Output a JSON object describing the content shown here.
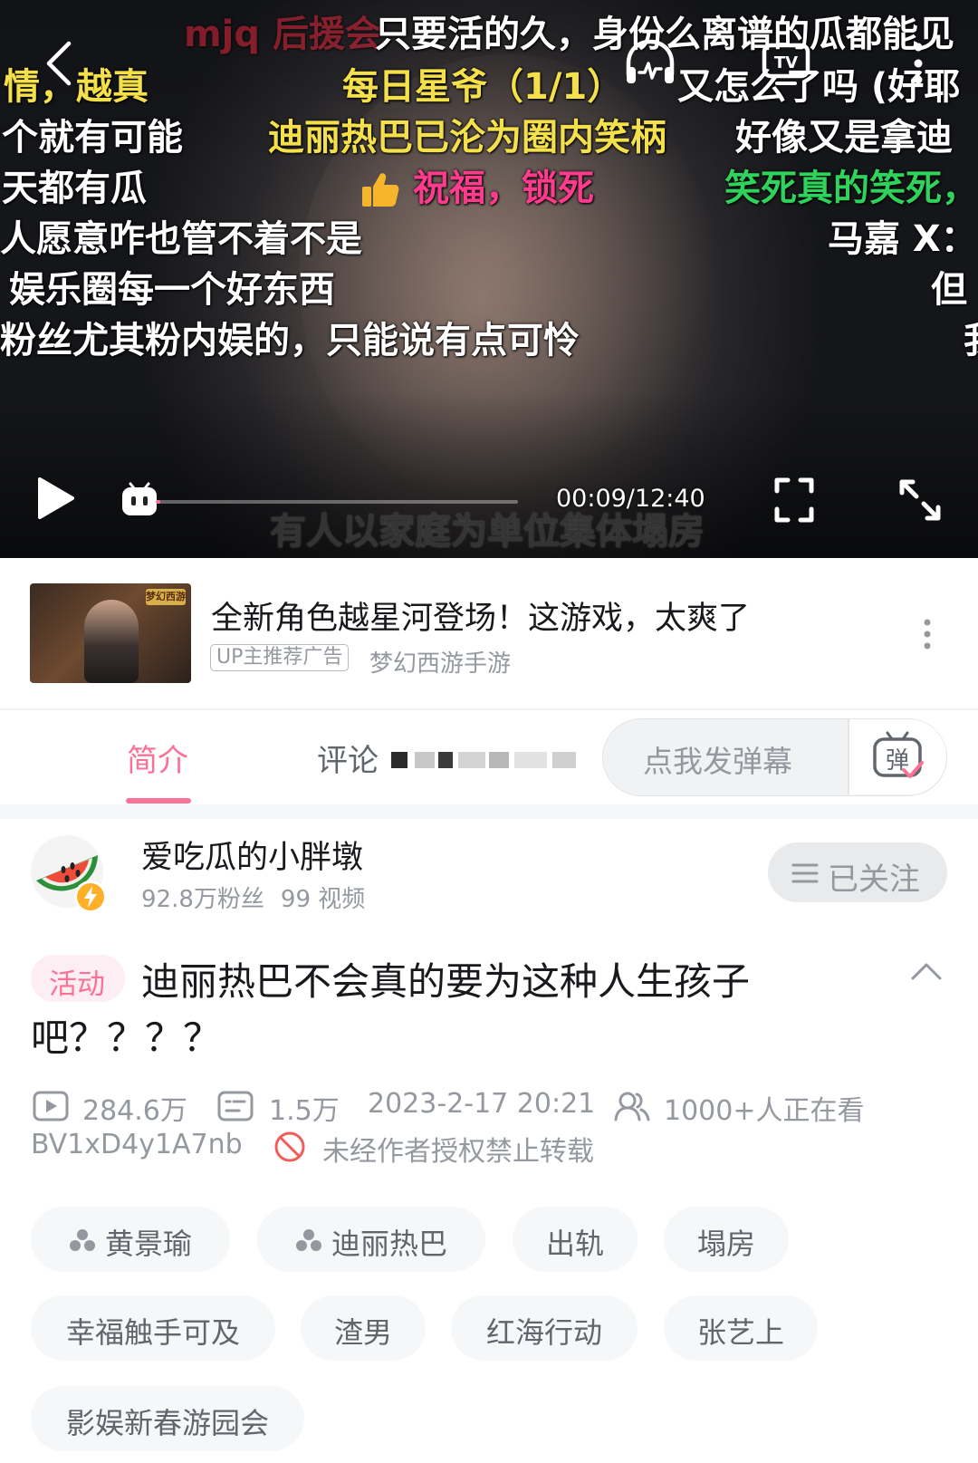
{
  "player": {
    "danmaku": [
      {
        "text": "mjq 后援会",
        "color": "red"
      },
      {
        "text": "只要活的久，身份么离谱的瓜都能见",
        "color": "white"
      },
      {
        "text": "情，越真",
        "color": "yellow"
      },
      {
        "text": "每日星爷（1/1）",
        "color": "yellow"
      },
      {
        "text": "又怎么了吗 (好耶",
        "color": "white"
      },
      {
        "text": "个就有可能",
        "color": "white"
      },
      {
        "text": "迪丽热巴已沦为圈内笑柄",
        "color": "yellow"
      },
      {
        "text": "好像又是拿迪",
        "color": "white"
      },
      {
        "text": "天都有瓜",
        "color": "white"
      },
      {
        "text": "祝福，锁死",
        "color": "pink"
      },
      {
        "text": "笑死真的笑死，",
        "color": "green"
      },
      {
        "text": "人愿意咋也管不着不是",
        "color": "white"
      },
      {
        "text": "马嘉 X：",
        "color": "white"
      },
      {
        "text": "娱乐圈每一个好东西",
        "color": "white"
      },
      {
        "text": "但",
        "color": "white"
      },
      {
        "text": "粉丝尤其粉内娱的，只能说有点可怜",
        "color": "white"
      },
      {
        "text": "我",
        "color": "white"
      }
    ],
    "subtitle": "有人以家庭为单位集体塌房",
    "timecode": "00:09/12:40",
    "progress": 0.012
  },
  "ad": {
    "title": "全新角色越星河登场！这游戏，太爽了",
    "badge": "UP主推荐广告",
    "source": "梦幻西游手游",
    "thumb_logo": "梦幻西游"
  },
  "tabs": {
    "intro": "简介",
    "comments": "评论",
    "danmaku_placeholder": "点我发弹幕",
    "danmaku_button": "弹"
  },
  "uploader": {
    "name": "爱吃瓜的小胖墩",
    "fans": "92.8万粉丝",
    "videos": "99 视频",
    "follow_label": "已关注"
  },
  "video": {
    "tag": "活动",
    "title_line1": "迪丽热巴不会真的要为这种人生孩子",
    "title_line2": "吧？？？？",
    "views": "284.6万",
    "danmaku_count": "1.5万",
    "date": "2023-2-17 20:21",
    "watching": "1000+人正在看",
    "bvid": "BV1xD4y1A7nb",
    "copyright": "未经作者授权禁止转载"
  },
  "tags": [
    {
      "label": "黄景瑜",
      "person": true
    },
    {
      "label": "迪丽热巴",
      "person": true
    },
    {
      "label": "出轨",
      "person": false
    },
    {
      "label": "塌房",
      "person": false
    },
    {
      "label": "幸福触手可及",
      "person": false
    },
    {
      "label": "渣男",
      "person": false
    },
    {
      "label": "红海行动",
      "person": false
    },
    {
      "label": "张艺上",
      "person": false
    },
    {
      "label": "影娱新春游园会",
      "person": false
    }
  ],
  "colors": {
    "accent": "#fb7299",
    "text_primary": "#18191c",
    "text_secondary": "#9499a0",
    "copyright_red": "#f25d59"
  }
}
